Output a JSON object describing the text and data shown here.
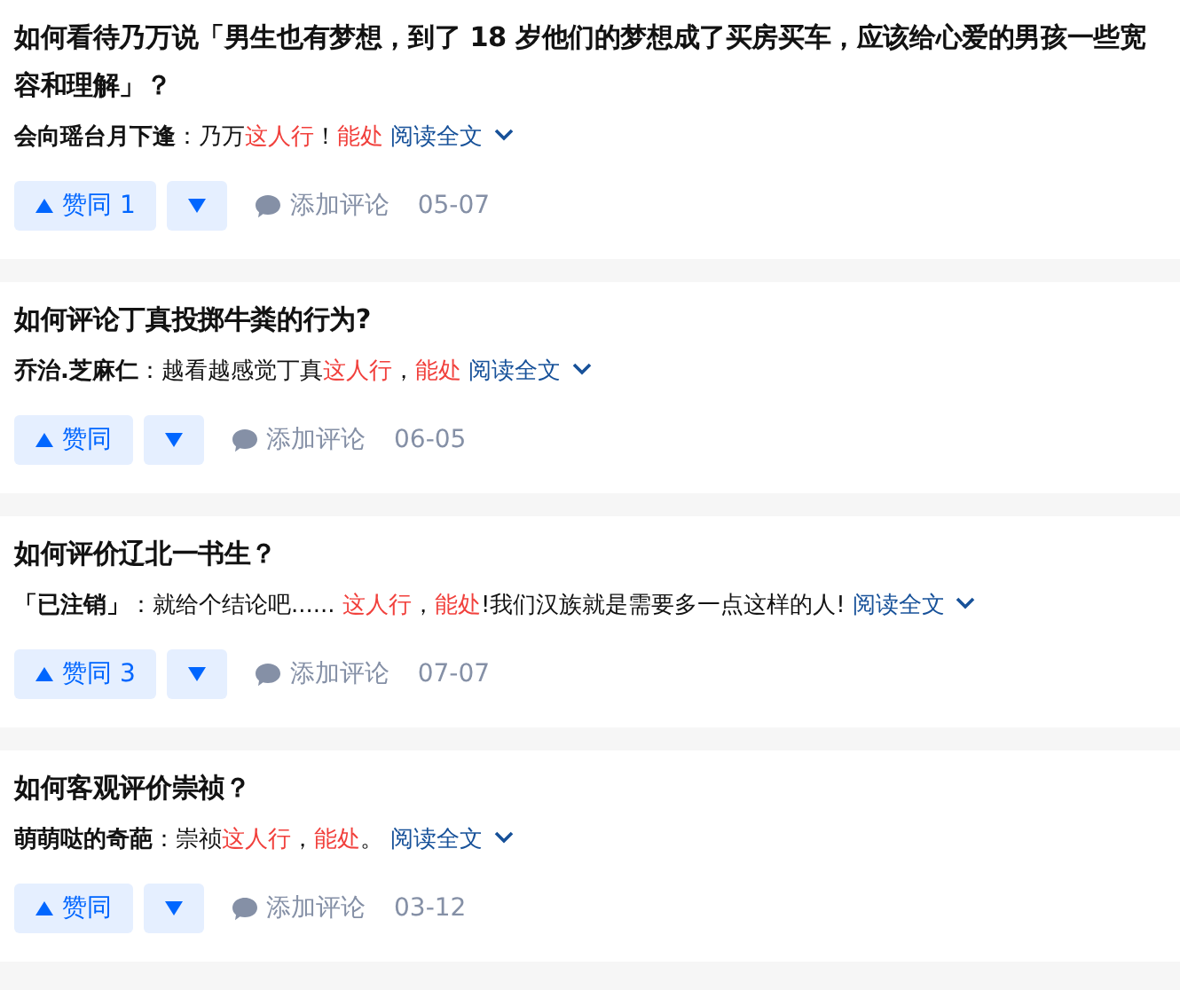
{
  "answers": [
    {
      "title": "如何看待乃万说「男生也有梦想，到了 18 岁他们的梦想成了买房买车，应该给心爱的男孩一些宽容和理解」？",
      "author": "会向瑶台月下逢",
      "excerpt": [
        "：乃万",
        "*这人行*！*能处*"
      ],
      "read_more": "阅读全文",
      "vote_label": "赞同",
      "vote_count": "1",
      "comment_label": "添加评论",
      "date": "05-07"
    },
    {
      "title": "如何评论丁真投掷牛粪的行为?",
      "author": "乔治.芝麻仁",
      "excerpt": [
        "：越看越感觉丁真",
        "*这人行*，*能处*"
      ],
      "read_more": "阅读全文",
      "vote_label": "赞同",
      "comment_label": "添加评论",
      "date": "06-05"
    },
    {
      "title": "如何评价辽北一书生？",
      "author": "「已注销」",
      "excerpt": [
        "：就给个结论吧...... *这人行*，*能处*!我们汉族就是需要多一点这样的人!"
      ],
      "read_more": "阅读全文",
      "vote_label": "赞同",
      "vote_count": "3",
      "comment_label": "添加评论",
      "date": "07-07"
    },
    {
      "title": "如何客观评价崇祯？",
      "author": "萌萌哒的奇葩",
      "excerpt": [
        "：崇祯",
        "*这人行*，*能处*。"
      ],
      "read_more": "阅读全文",
      "vote_label": "赞同",
      "comment_label": "添加评论",
      "date": "03-12"
    }
  ]
}
